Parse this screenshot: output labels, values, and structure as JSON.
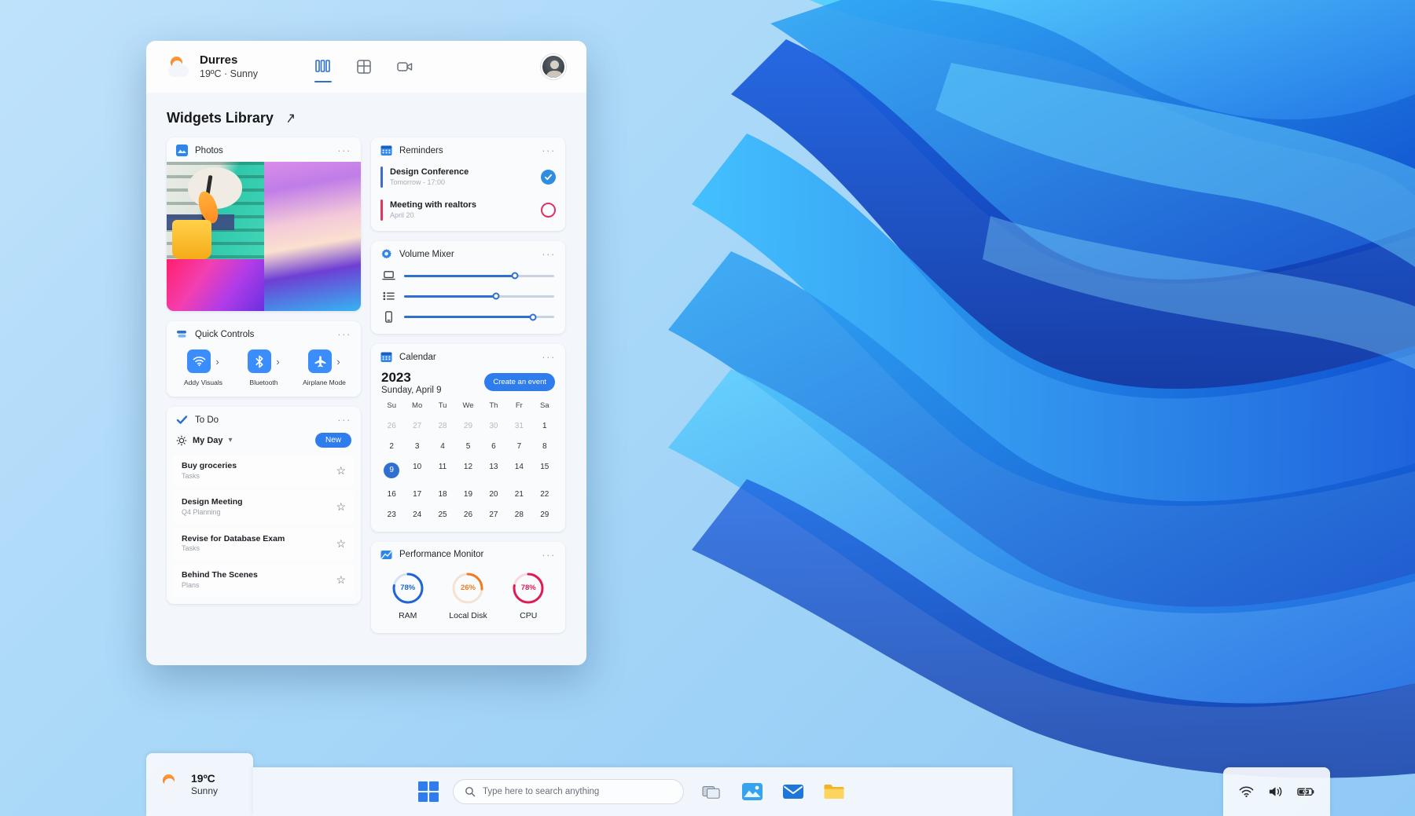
{
  "header": {
    "location": "Durres",
    "weather": "19ºC · Sunny",
    "tabs": [
      {
        "name": "widgets-board-tab",
        "icon": "book-columns-icon",
        "active": true
      },
      {
        "name": "grid-layout-tab",
        "icon": "grid-icon",
        "active": false
      },
      {
        "name": "video-tab",
        "icon": "video-camera-icon",
        "active": false
      }
    ]
  },
  "library": {
    "title": "Widgets Library",
    "expand_icon": "expand-arrow-icon"
  },
  "photos": {
    "title": "Photos",
    "menu": "···"
  },
  "quick_controls": {
    "title": "Quick Controls",
    "menu": "···",
    "items": [
      {
        "label": "Addy Visuals",
        "icon": "wifi-icon"
      },
      {
        "label": "Bluetooth",
        "icon": "bluetooth-icon"
      },
      {
        "label": "Airplane Mode",
        "icon": "airplane-icon"
      }
    ]
  },
  "todo": {
    "title": "To Do",
    "menu": "···",
    "list_name": "My Day",
    "new_label": "New",
    "items": [
      {
        "title": "Buy groceries",
        "sub": "Tasks"
      },
      {
        "title": "Design Meeting",
        "sub": "Q4 Planning"
      },
      {
        "title": "Revise for Database Exam",
        "sub": "Tasks"
      },
      {
        "title": "Behind The Scenes",
        "sub": "Plans"
      }
    ]
  },
  "reminders": {
    "title": "Reminders",
    "menu": "···",
    "items": [
      {
        "title": "Design Conference",
        "sub": "Tomorrow - 17:00",
        "bar_color": "#3f6cc4",
        "done": true
      },
      {
        "title": "Meeting with realtors",
        "sub": "April 20",
        "bar_color": "#d63a63",
        "done": false
      }
    ]
  },
  "volume_mixer": {
    "title": "Volume Mixer",
    "menu": "···",
    "sliders": [
      {
        "icon": "laptop-icon",
        "value": 74
      },
      {
        "icon": "media-list-icon",
        "value": 61
      },
      {
        "icon": "phone-icon",
        "value": 86
      }
    ]
  },
  "calendar": {
    "title": "Calendar",
    "menu": "···",
    "year": "2023",
    "date": "Sunday, April 9",
    "create_label": "Create an event",
    "dow": [
      "Su",
      "Mo",
      "Tu",
      "We",
      "Th",
      "Fr",
      "Sa"
    ],
    "weeks": [
      [
        {
          "d": "26",
          "dim": true
        },
        {
          "d": "27",
          "dim": true
        },
        {
          "d": "28",
          "dim": true
        },
        {
          "d": "29",
          "dim": true
        },
        {
          "d": "30",
          "dim": true
        },
        {
          "d": "31",
          "dim": true
        },
        {
          "d": "1",
          "dim": false
        }
      ],
      [
        {
          "d": "2",
          "dim": false
        },
        {
          "d": "3",
          "dim": false
        },
        {
          "d": "4",
          "dim": false
        },
        {
          "d": "5",
          "dim": false
        },
        {
          "d": "6",
          "dim": false
        },
        {
          "d": "7",
          "dim": false
        },
        {
          "d": "8",
          "dim": false
        }
      ],
      [
        {
          "d": "9",
          "dim": false,
          "sel": true
        },
        {
          "d": "10",
          "dim": false
        },
        {
          "d": "11",
          "dim": false
        },
        {
          "d": "12",
          "dim": false
        },
        {
          "d": "13",
          "dim": false
        },
        {
          "d": "14",
          "dim": false
        },
        {
          "d": "15",
          "dim": false
        }
      ],
      [
        {
          "d": "16",
          "dim": false
        },
        {
          "d": "17",
          "dim": false
        },
        {
          "d": "18",
          "dim": false
        },
        {
          "d": "19",
          "dim": false
        },
        {
          "d": "20",
          "dim": false
        },
        {
          "d": "21",
          "dim": false
        },
        {
          "d": "22",
          "dim": false
        }
      ],
      [
        {
          "d": "23",
          "dim": false
        },
        {
          "d": "24",
          "dim": false
        },
        {
          "d": "25",
          "dim": false
        },
        {
          "d": "26",
          "dim": false
        },
        {
          "d": "27",
          "dim": false
        },
        {
          "d": "28",
          "dim": false
        },
        {
          "d": "29",
          "dim": false
        }
      ]
    ]
  },
  "performance": {
    "title": "Performance Monitor",
    "menu": "···",
    "gauges": [
      {
        "label": "RAM",
        "value": "78%",
        "percent": 78,
        "color": "#1f63d6"
      },
      {
        "label": "Local Disk",
        "value": "26%",
        "percent": 26,
        "color": "#f07a20"
      },
      {
        "label": "CPU",
        "value": "78%",
        "percent": 78,
        "color": "#e01b53"
      }
    ]
  },
  "taskbar": {
    "weather": {
      "temp": "19ºC",
      "cond": "Sunny"
    },
    "search_placeholder": "Type here to search anything",
    "apps": [
      {
        "name": "task-view-icon"
      },
      {
        "name": "photos-app-icon"
      },
      {
        "name": "mail-app-icon"
      },
      {
        "name": "file-explorer-icon"
      }
    ],
    "tray": [
      {
        "name": "wifi-tray-icon"
      },
      {
        "name": "volume-tray-icon"
      },
      {
        "name": "battery-tray-icon"
      }
    ]
  }
}
